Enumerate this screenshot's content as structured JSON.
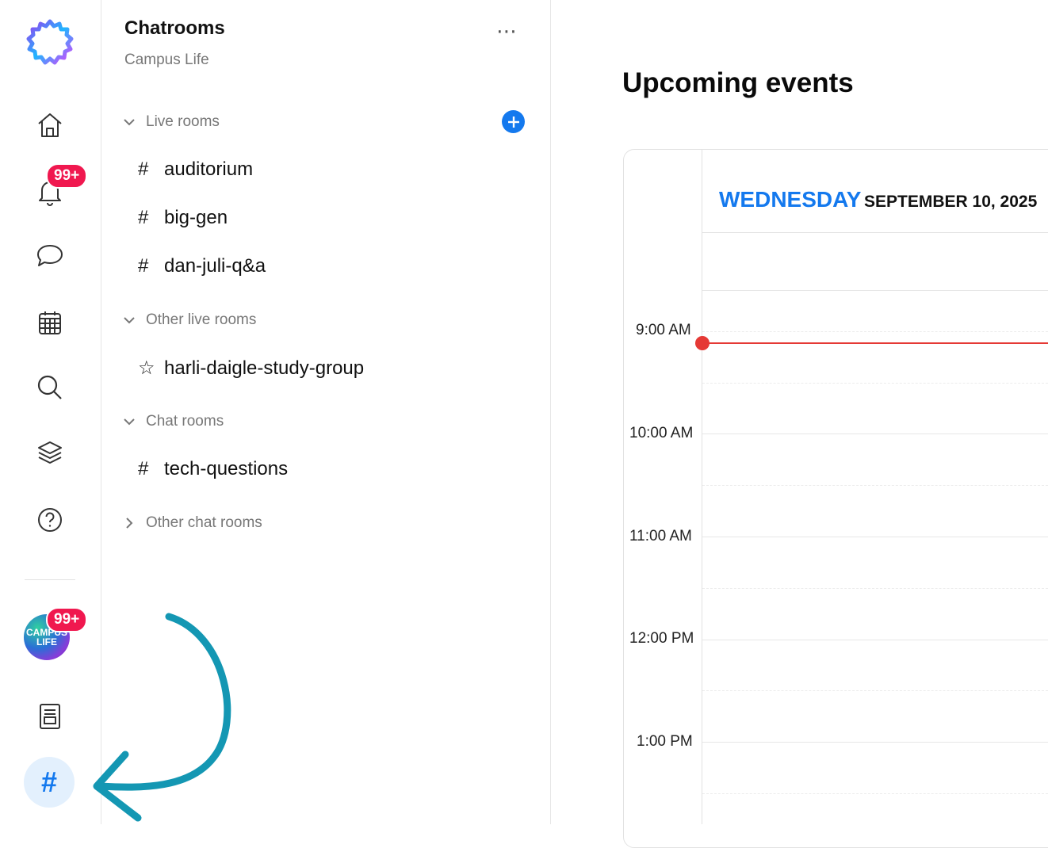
{
  "rail": {
    "notifications_badge": "99+",
    "campus_badge": "99+",
    "campus_avatar_line1": "CAMPUS",
    "campus_avatar_line2": "LIFE",
    "active_symbol": "#",
    "icons": [
      "logo-icon",
      "home-icon",
      "bell-icon",
      "chat-bubble-icon",
      "calendar-icon",
      "search-icon",
      "layers-icon",
      "help-icon",
      "document-icon",
      "hash-icon"
    ]
  },
  "panel": {
    "title": "Chatrooms",
    "subtitle": "Campus Life",
    "more": "⋯",
    "sections": [
      {
        "label": "Live rooms",
        "expanded": true
      },
      {
        "label": "Other live rooms",
        "expanded": true
      },
      {
        "label": "Chat rooms",
        "expanded": true
      },
      {
        "label": "Other chat rooms",
        "expanded": false
      }
    ],
    "rooms": [
      {
        "symbol": "#",
        "name": "auditorium"
      },
      {
        "symbol": "#",
        "name": "big-gen"
      },
      {
        "symbol": "#",
        "name": "dan-juli-q&a"
      },
      {
        "symbol": "☆",
        "name": "harli-daigle-study-group"
      },
      {
        "symbol": "#",
        "name": "tech-questions"
      }
    ]
  },
  "main": {
    "title": "Upcoming events",
    "calendar": {
      "day": "WEDNESDAY",
      "date": "SEPTEMBER 10, 2025",
      "times": [
        "9:00 AM",
        "10:00 AM",
        "11:00 AM",
        "12:00 PM",
        "1:00 PM"
      ]
    }
  },
  "colors": {
    "accent": "#1479ee",
    "badge": "#f0184f",
    "now_line": "#e53935",
    "arrow": "#1497b3"
  }
}
